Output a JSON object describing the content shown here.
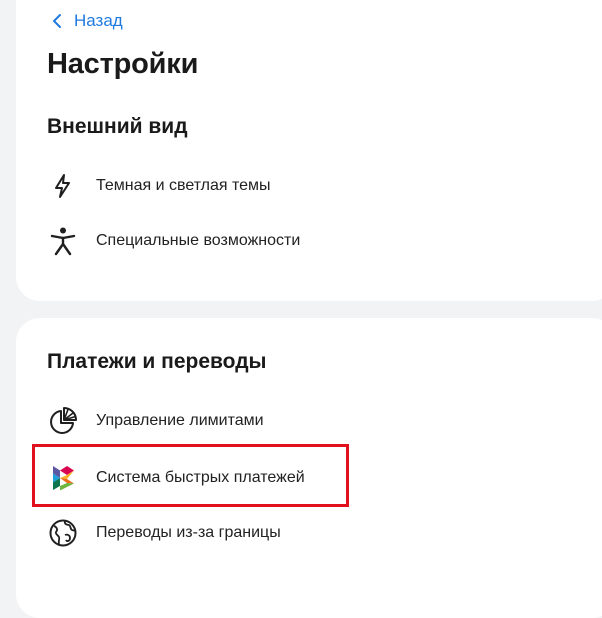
{
  "nav": {
    "back_label": "Назад"
  },
  "page": {
    "title": "Настройки"
  },
  "sections": {
    "appearance": {
      "title": "Внешний вид",
      "items": [
        {
          "label": "Темная и светлая темы",
          "icon": "lightning-icon"
        },
        {
          "label": "Специальные возможности",
          "icon": "accessibility-icon"
        }
      ]
    },
    "payments": {
      "title": "Платежи и переводы",
      "items": [
        {
          "label": "Управление лимитами",
          "icon": "pie-chart-icon"
        },
        {
          "label": "Система быстрых платежей",
          "icon": "sbp-logo-icon"
        },
        {
          "label": "Переводы из-за границы",
          "icon": "globe-icon"
        }
      ]
    }
  },
  "colors": {
    "link": "#1f7ae0",
    "highlight": "#e0101c",
    "card": "#ffffff",
    "background": "#f2f3f5"
  }
}
